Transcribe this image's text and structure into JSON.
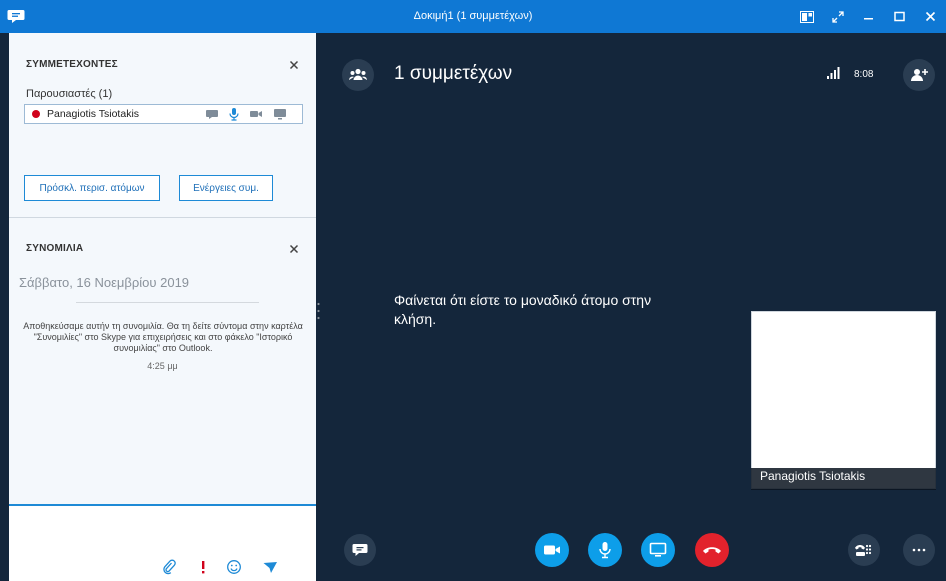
{
  "window": {
    "title": "Δοκιμή1 (1 συμμετέχων)"
  },
  "participants_panel": {
    "title": "ΣΥΜΜΕΤΕΧΟΝΤΕΣ",
    "presenters_heading": "Παρουσιαστές (1)",
    "participant_name": "Panagiotis Tsiotakis",
    "invite_button": "Πρόσκλ. περισ. ατόμων",
    "actions_button": "Ενέργειες συμ."
  },
  "conversation_panel": {
    "title": "ΣΥΝΟΜΙΛΙΑ",
    "date": "Σάββατο, 16 Νοεμβρίου 2019",
    "notice": "Αποθηκεύσαμε αυτήν τη συνομιλία. Θα τη δείτε σύντομα στην καρτέλα \"Συνομιλίες\" στο Skype για επιχειρήσεις και στο φάκελο \"Ιστορικό συνομιλίας\" στο Outlook.",
    "time": "4:25 μμ"
  },
  "stage": {
    "participant_count": "1 συμμετέχων",
    "clock": "8:08",
    "alone_message": "Φαίνεται ότι είστε το μοναδικό άτομο στην κλήση.",
    "self_name": "Panagiotis Tsiotakis"
  },
  "icons": {
    "app": "skype-chat-bubble-icon",
    "participants": "people-icon",
    "add_person": "add-person-icon",
    "chat": "chat-bubble-icon",
    "video": "video-camera-icon",
    "mic": "microphone-icon",
    "screen": "monitor-icon",
    "hangup": "hang-up-phone-icon",
    "dialpad": "phone-dialpad-icon",
    "more": "ellipsis-icon"
  },
  "colors": {
    "titlebar": "#0f78d4",
    "stage_bg": "#14263b",
    "accent_blue": "#0d9ee9",
    "hangup_red": "#e2222c",
    "presence_busy": "#d0021b"
  }
}
